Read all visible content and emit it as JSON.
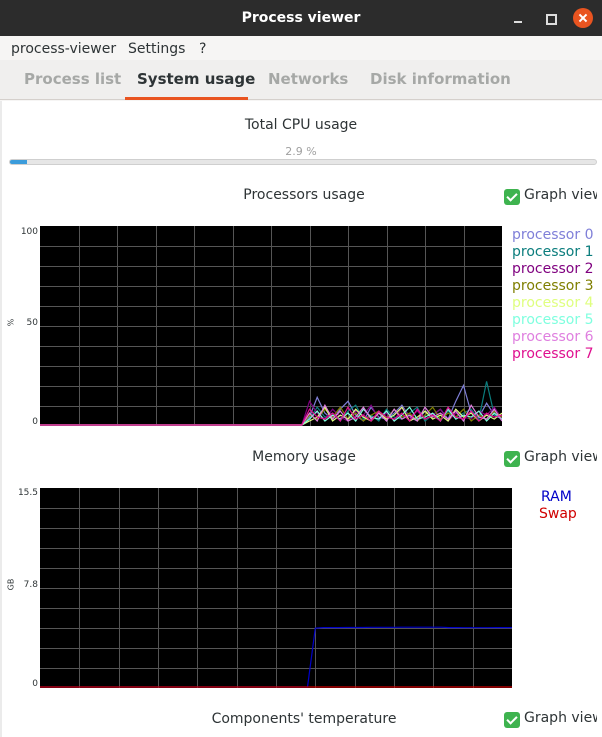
{
  "window": {
    "title": "Process viewer"
  },
  "menu": [
    "process-viewer",
    "Settings",
    "?"
  ],
  "tabs": [
    "Process list",
    "System usage",
    "Networks",
    "Disk information"
  ],
  "active_tab": 1,
  "cpu_total": {
    "title": "Total CPU usage",
    "percent_text": "2.9 %",
    "fraction": 0.029
  },
  "processors": {
    "title": "Processors usage",
    "graph_view_label": "Graph view",
    "graph_view_checked": true,
    "y_unit": "%",
    "y_ticks": [
      "100",
      "50",
      "0"
    ],
    "legend": [
      {
        "name": "processor 0",
        "color": "#7f7fd8"
      },
      {
        "name": "processor 1",
        "color": "#0b7d7d"
      },
      {
        "name": "processor 2",
        "color": "#7f007f"
      },
      {
        "name": "processor 3",
        "color": "#7f7f00"
      },
      {
        "name": "processor 4",
        "color": "#dfff7f"
      },
      {
        "name": "processor 5",
        "color": "#7fffdf"
      },
      {
        "name": "processor 6",
        "color": "#df7fdf"
      },
      {
        "name": "processor 7",
        "color": "#df0f8f"
      }
    ]
  },
  "memory": {
    "title": "Memory usage",
    "graph_view_label": "Graph view",
    "graph_view_checked": true,
    "y_unit": "GB",
    "y_ticks": [
      "15.5",
      "7.8",
      "0"
    ],
    "legend": [
      {
        "name": "RAM",
        "color": "#0000c8"
      },
      {
        "name": "Swap",
        "color": "#d00000"
      }
    ]
  },
  "temperature": {
    "title": "Components' temperature",
    "graph_view_label": "Graph view",
    "graph_view_checked": true
  },
  "chart_data": [
    {
      "type": "line",
      "title": "Processors usage",
      "ylabel": "%",
      "ylim": [
        0,
        100
      ],
      "grid": true,
      "legend": "right",
      "x": [
        0,
        1,
        2,
        3,
        4,
        5,
        6,
        7,
        8,
        9,
        10,
        11,
        12,
        13,
        14,
        15,
        16,
        17,
        18,
        19,
        20,
        21,
        22,
        23,
        24,
        25,
        26,
        27,
        28,
        29,
        30,
        31,
        32,
        33,
        34,
        35,
        36,
        37,
        38,
        39,
        40,
        41,
        42,
        43,
        44,
        45,
        46,
        47,
        48,
        49,
        50,
        51,
        52,
        53,
        54,
        55,
        56,
        57,
        58,
        59,
        60
      ],
      "series": [
        {
          "name": "processor 0",
          "color": "#7f7fd8",
          "values": [
            0,
            0,
            0,
            0,
            0,
            0,
            0,
            0,
            0,
            0,
            0,
            0,
            0,
            0,
            0,
            0,
            0,
            0,
            0,
            0,
            0,
            0,
            0,
            0,
            0,
            0,
            0,
            0,
            0,
            0,
            0,
            0,
            0,
            0,
            0,
            4,
            14,
            6,
            3,
            8,
            12,
            5,
            2,
            9,
            4,
            3,
            6,
            10,
            4,
            2,
            7,
            5,
            8,
            3,
            12,
            20,
            6,
            4,
            11,
            5,
            3
          ]
        },
        {
          "name": "processor 1",
          "color": "#0b7d7d",
          "values": [
            0,
            0,
            0,
            0,
            0,
            0,
            0,
            0,
            0,
            0,
            0,
            0,
            0,
            0,
            0,
            0,
            0,
            0,
            0,
            0,
            0,
            0,
            0,
            0,
            0,
            0,
            0,
            0,
            0,
            0,
            0,
            0,
            0,
            0,
            0,
            3,
            9,
            4,
            6,
            2,
            7,
            10,
            3,
            5,
            2,
            8,
            4,
            3,
            6,
            9,
            2,
            5,
            3,
            7,
            4,
            6,
            8,
            3,
            22,
            5,
            4
          ]
        },
        {
          "name": "processor 2",
          "color": "#7f007f",
          "values": [
            0,
            0,
            0,
            0,
            0,
            0,
            0,
            0,
            0,
            0,
            0,
            0,
            0,
            0,
            0,
            0,
            0,
            0,
            0,
            0,
            0,
            0,
            0,
            0,
            0,
            0,
            0,
            0,
            0,
            0,
            0,
            0,
            0,
            0,
            0,
            12,
            6,
            3,
            8,
            4,
            2,
            7,
            5,
            10,
            3,
            6,
            2,
            9,
            4,
            7,
            3,
            5,
            8,
            2,
            6,
            4,
            3,
            7,
            5,
            9,
            3
          ]
        },
        {
          "name": "processor 3",
          "color": "#7f7f00",
          "values": [
            0,
            0,
            0,
            0,
            0,
            0,
            0,
            0,
            0,
            0,
            0,
            0,
            0,
            0,
            0,
            0,
            0,
            0,
            0,
            0,
            0,
            0,
            0,
            0,
            0,
            0,
            0,
            0,
            0,
            0,
            0,
            0,
            0,
            0,
            0,
            5,
            3,
            8,
            4,
            9,
            3,
            6,
            2,
            5,
            7,
            3,
            8,
            4,
            6,
            2,
            5,
            9,
            3,
            6,
            4,
            8,
            2,
            5,
            3,
            7,
            4
          ]
        },
        {
          "name": "processor 4",
          "color": "#dfff7f",
          "values": [
            0,
            0,
            0,
            0,
            0,
            0,
            0,
            0,
            0,
            0,
            0,
            0,
            0,
            0,
            0,
            0,
            0,
            0,
            0,
            0,
            0,
            0,
            0,
            0,
            0,
            0,
            0,
            0,
            0,
            0,
            0,
            0,
            0,
            0,
            0,
            2,
            4,
            9,
            2,
            5,
            3,
            8,
            4,
            2,
            6,
            3,
            5,
            9,
            2,
            4,
            7,
            3,
            5,
            2,
            8,
            4,
            6,
            2,
            5,
            3,
            6
          ]
        },
        {
          "name": "processor 5",
          "color": "#7fffdf",
          "values": [
            0,
            0,
            0,
            0,
            0,
            0,
            0,
            0,
            0,
            0,
            0,
            0,
            0,
            0,
            0,
            0,
            0,
            0,
            0,
            0,
            0,
            0,
            0,
            0,
            0,
            0,
            0,
            0,
            0,
            0,
            0,
            0,
            0,
            0,
            0,
            3,
            7,
            2,
            5,
            3,
            6,
            2,
            8,
            4,
            3,
            7,
            2,
            5,
            9,
            3,
            4,
            6,
            2,
            8,
            3,
            5,
            4,
            7,
            2,
            6,
            3
          ]
        },
        {
          "name": "processor 6",
          "color": "#df7fdf",
          "values": [
            0,
            0,
            0,
            0,
            0,
            0,
            0,
            0,
            0,
            0,
            0,
            0,
            0,
            0,
            0,
            0,
            0,
            0,
            0,
            0,
            0,
            0,
            0,
            0,
            0,
            0,
            0,
            0,
            0,
            0,
            0,
            0,
            0,
            0,
            0,
            6,
            2,
            10,
            3,
            7,
            2,
            4,
            9,
            3,
            6,
            2,
            8,
            3,
            5,
            2,
            9,
            4,
            6,
            3,
            7,
            2,
            10,
            4,
            3,
            8,
            2
          ]
        },
        {
          "name": "processor 7",
          "color": "#df0f8f",
          "values": [
            0,
            0,
            0,
            0,
            0,
            0,
            0,
            0,
            0,
            0,
            0,
            0,
            0,
            0,
            0,
            0,
            0,
            0,
            0,
            0,
            0,
            0,
            0,
            0,
            0,
            0,
            0,
            0,
            0,
            0,
            0,
            0,
            0,
            0,
            0,
            8,
            4,
            3,
            6,
            2,
            9,
            3,
            5,
            2,
            7,
            4,
            3,
            6,
            2,
            8,
            3,
            5,
            2,
            9,
            4,
            3,
            7,
            2,
            6,
            4,
            5
          ]
        }
      ]
    },
    {
      "type": "line",
      "title": "Memory usage",
      "ylabel": "GB",
      "ylim": [
        0,
        15.5
      ],
      "grid": true,
      "legend": "right",
      "x": [
        0,
        1,
        2,
        3,
        4,
        5,
        6,
        7,
        8,
        9,
        10,
        11,
        12,
        13,
        14,
        15,
        16,
        17,
        18,
        19,
        20,
        21,
        22,
        23,
        24,
        25,
        26,
        27,
        28,
        29,
        30,
        31,
        32,
        33,
        34,
        35,
        36,
        37,
        38,
        39,
        40,
        41,
        42,
        43,
        44,
        45,
        46,
        47,
        48,
        49,
        50,
        51,
        52,
        53,
        54,
        55,
        56,
        57,
        58,
        59,
        60
      ],
      "series": [
        {
          "name": "RAM",
          "color": "#0000c8",
          "values": [
            0,
            0,
            0,
            0,
            0,
            0,
            0,
            0,
            0,
            0,
            0,
            0,
            0,
            0,
            0,
            0,
            0,
            0,
            0,
            0,
            0,
            0,
            0,
            0,
            0,
            0,
            0,
            0,
            0,
            0,
            0,
            0,
            0,
            0,
            0,
            4.6,
            4.65,
            4.65,
            4.65,
            4.66,
            4.66,
            4.66,
            4.67,
            4.67,
            4.67,
            4.67,
            4.68,
            4.68,
            4.68,
            4.68,
            4.68,
            4.68,
            4.65,
            4.65,
            4.64,
            4.64,
            4.64,
            4.64,
            4.65,
            4.65,
            4.65
          ]
        },
        {
          "name": "Swap",
          "color": "#d00000",
          "values": [
            0,
            0,
            0,
            0,
            0,
            0,
            0,
            0,
            0,
            0,
            0,
            0,
            0,
            0,
            0,
            0,
            0,
            0,
            0,
            0,
            0,
            0,
            0,
            0,
            0,
            0,
            0,
            0,
            0,
            0,
            0,
            0,
            0,
            0,
            0,
            0,
            0,
            0,
            0,
            0,
            0,
            0,
            0,
            0,
            0,
            0,
            0,
            0,
            0,
            0,
            0,
            0,
            0,
            0,
            0,
            0,
            0,
            0,
            0,
            0,
            0
          ]
        }
      ]
    }
  ]
}
